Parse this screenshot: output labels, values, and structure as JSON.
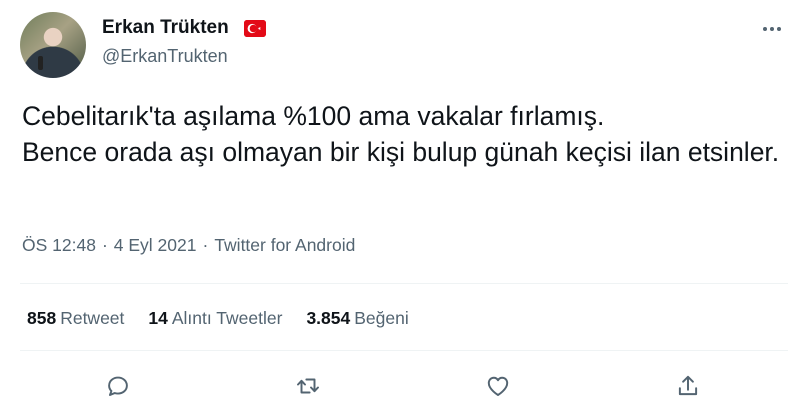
{
  "author": {
    "display_name": "Erkan Trükten",
    "handle": "@ErkanTrukten",
    "flag_icon": "turkey-flag-icon"
  },
  "tweet": {
    "text": "Cebelitarık'ta aşılama %100 ama vakalar fırlamış.\nBence orada aşı olmayan bir kişi bulup günah keçisi ilan etsinler."
  },
  "meta": {
    "time": "ÖS 12:48",
    "separator": "·",
    "date": "4 Eyl 2021",
    "source": "Twitter for Android"
  },
  "stats": [
    {
      "count": "858",
      "label": "Retweet"
    },
    {
      "count": "14",
      "label": "Alıntı Tweetler"
    },
    {
      "count": "3.854",
      "label": "Beğeni"
    }
  ],
  "actions": [
    "reply-icon",
    "retweet-icon",
    "like-icon",
    "share-icon"
  ],
  "colors": {
    "text_primary": "#0f1419",
    "text_secondary": "#536471",
    "divider": "#eff3f4",
    "flag_red": "#e30a17"
  }
}
